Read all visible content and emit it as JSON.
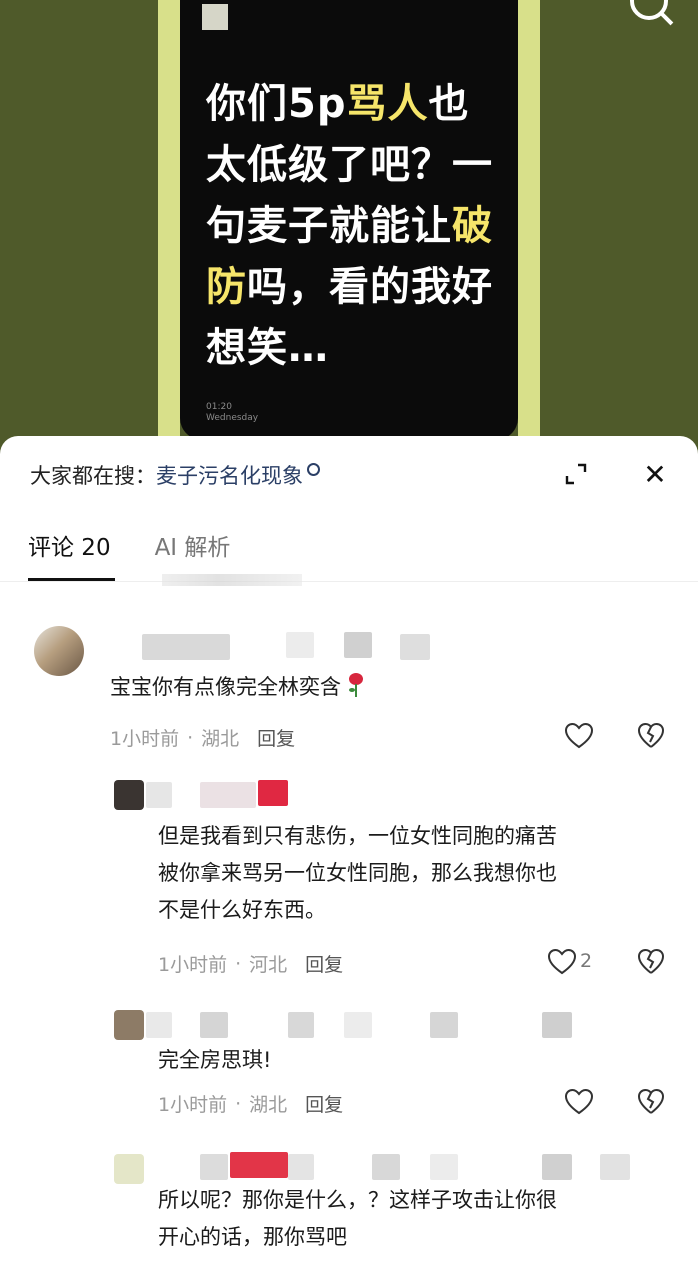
{
  "video": {
    "headline_plain_1": "你们5p",
    "headline_hl_1": "骂人",
    "headline_plain_2": "也太低级了吧？一句麦子就能让",
    "headline_hl_2": "破防",
    "headline_plain_3": "吗，看的我好想笑…",
    "time": "01:20",
    "weekday": "Wednesday"
  },
  "search_suggest": {
    "prefix": "大家都在搜：",
    "query": "麦子污名化现象"
  },
  "tabs": [
    {
      "label": "评论 20",
      "active": true
    },
    {
      "label": "AI 解析",
      "active": false
    }
  ],
  "comments": [
    {
      "text": "宝宝你有点像完全林奕含",
      "emoji": "rose",
      "time": "1小时前",
      "location": "湖北",
      "reply": "回复",
      "likes": ""
    },
    {
      "text": "但是我看到只有悲伤，一位女性同胞的痛苦被你拿来骂另一位女性同胞，那么我想你也不是什么好东西。",
      "text_lines": [
        "但是我看到只有悲伤，一位女性同胞的痛苦",
        "被你拿来骂另一位女性同胞，那么我想你也",
        "不是什么好东西。"
      ],
      "time": "1小时前",
      "location": "河北",
      "reply": "回复",
      "likes": "2"
    },
    {
      "text": "完全房思琪!",
      "time": "1小时前",
      "location": "湖北",
      "reply": "回复",
      "likes": ""
    },
    {
      "text_lines": [
        "所以呢？那你是什么，？这样子攻击让你很",
        "开心的话，那你骂吧"
      ]
    }
  ],
  "colors": {
    "video_bg": "#4f5a2a",
    "accent_yellow": "#f6e56a",
    "query_blue": "#2b3f66"
  }
}
